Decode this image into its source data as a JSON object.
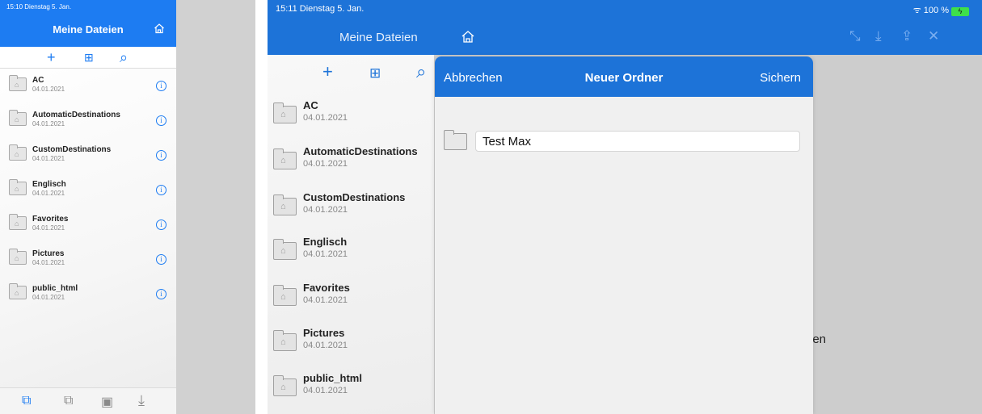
{
  "left": {
    "status_time": "15:10  Dienstag 5. Jan.",
    "title": "Meine Dateien",
    "toolbar": {
      "add": "+",
      "new_folder": "⊞",
      "search": "⌕"
    },
    "items": [
      {
        "name": "AC",
        "date": "04.01.2021"
      },
      {
        "name": "AutomaticDestinations",
        "date": "04.01.2021"
      },
      {
        "name": "CustomDestinations",
        "date": "04.01.2021"
      },
      {
        "name": "Englisch",
        "date": "04.01.2021"
      },
      {
        "name": "Favorites",
        "date": "04.01.2021"
      },
      {
        "name": "Pictures",
        "date": "04.01.2021"
      },
      {
        "name": "public_html",
        "date": "04.01.2021"
      }
    ],
    "info_glyph": "i",
    "bottom_tabs": [
      "⧉",
      "⧉",
      "▣",
      "⤓"
    ]
  },
  "right": {
    "status_time": "15:11   Dienstag 5. Jan.",
    "battery": "ᯤ 100 %",
    "battery_icon": "ϟ",
    "title": "Meine Dateien",
    "actions": [
      "⤡",
      "⤓",
      "⇪",
      "✕"
    ],
    "toolbar": {
      "add": "+",
      "new_folder": "⊞",
      "search": "⌕"
    },
    "items": [
      {
        "name": "AC",
        "date": "04.01.2021"
      },
      {
        "name": "AutomaticDestinations",
        "date": "04.01.2021"
      },
      {
        "name": "CustomDestinations",
        "date": "04.01.2021"
      },
      {
        "name": "Englisch",
        "date": "04.01.2021"
      },
      {
        "name": "Favorites",
        "date": "04.01.2021"
      },
      {
        "name": "Pictures",
        "date": "04.01.2021"
      },
      {
        "name": "public_html",
        "date": "04.01.2021"
      }
    ],
    "background_text": "len",
    "dialog": {
      "cancel": "Abbrechen",
      "title": "Neuer Ordner",
      "save": "Sichern",
      "folder_name_value": "Test Max"
    }
  },
  "colors": {
    "accent": "#1d7cf2",
    "accent_dark": "#1d73d8",
    "battery": "#3ee04a"
  }
}
